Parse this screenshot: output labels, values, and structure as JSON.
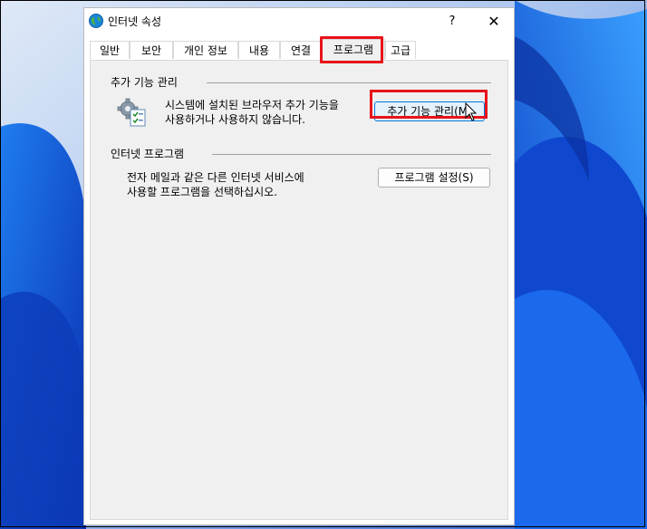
{
  "window": {
    "title": "인터넷 속성",
    "help_label": "?",
    "close_label": "✕"
  },
  "tabs": [
    {
      "label": "일반",
      "active": false
    },
    {
      "label": "보안",
      "active": false
    },
    {
      "label": "개인 정보",
      "active": false
    },
    {
      "label": "내용",
      "active": false
    },
    {
      "label": "연결",
      "active": false
    },
    {
      "label": "프로그램",
      "active": true
    },
    {
      "label": "고급",
      "active": false
    }
  ],
  "addons": {
    "group_title": "추가 기능 관리",
    "description_line1": "시스템에 설치된 브라우저 추가 기능을",
    "description_line2": "사용하거나 사용하지 않습니다.",
    "button_label": "추가 기능 관리(M)",
    "icon": "gear-checklist-icon"
  },
  "internet_programs": {
    "group_title": "인터넷 프로그램",
    "description_line1": "전자 메일과 같은 다른 인터넷 서비스에",
    "description_line2": "사용할 프로그램을 선택하십시오.",
    "button_label": "프로그램 설정(S)"
  },
  "colors": {
    "highlight": "#e8141a",
    "focus_border": "#0078d7",
    "panel_bg": "#f0f0f0"
  }
}
